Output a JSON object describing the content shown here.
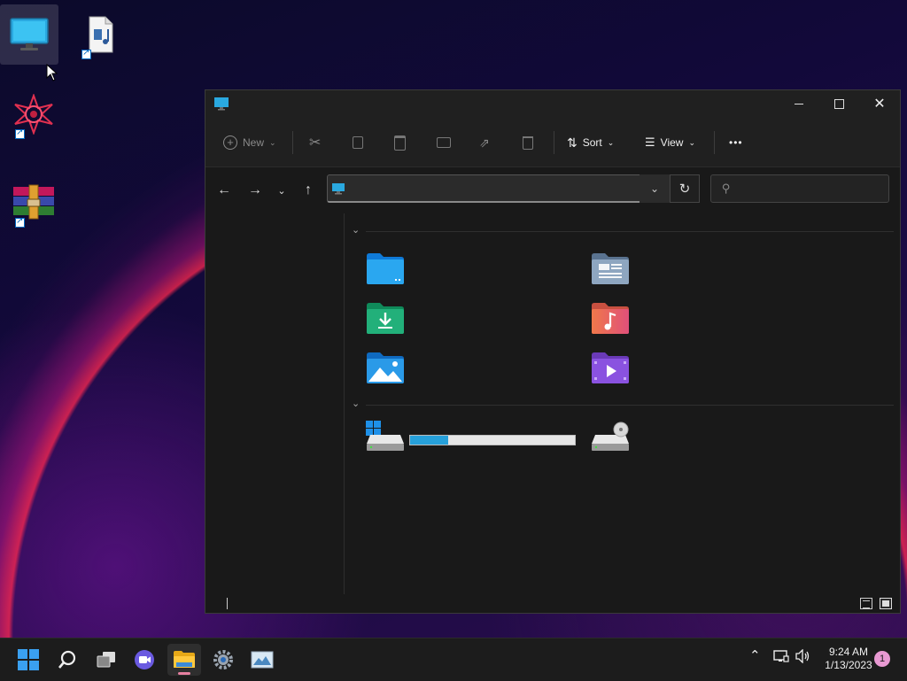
{
  "desktop": {
    "icons": [
      {
        "name": "this-pc",
        "selected": true
      },
      {
        "name": "media-file-shortcut"
      },
      {
        "name": "app-shortcut"
      },
      {
        "name": "winrar-shortcut"
      }
    ]
  },
  "explorer": {
    "toolbar": {
      "new_label": "New",
      "sort_label": "Sort",
      "view_label": "View",
      "more_label": "•••"
    },
    "address": {
      "value": ""
    },
    "search": {
      "placeholder": ""
    },
    "drives": [
      {
        "name": "local-disk",
        "used_fraction": 0.23
      }
    ]
  },
  "taskbar": {
    "time": "9:24 AM",
    "date": "1/13/2023",
    "notification_count": "1"
  },
  "colors": {
    "accent": "#0078d4",
    "progress_fill": "#26a0da",
    "notif_badge": "#e899d2"
  }
}
